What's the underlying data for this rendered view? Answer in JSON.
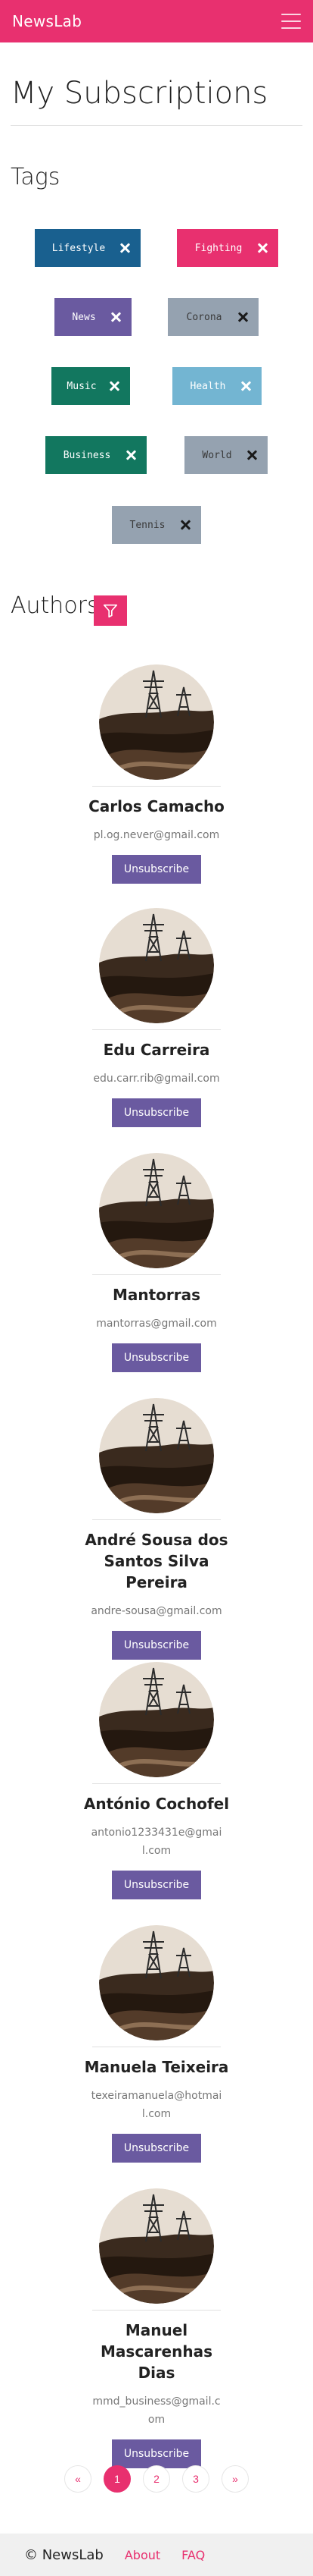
{
  "navbar": {
    "brand": "NewsLab",
    "menu_icon": "hamburger-icon"
  },
  "page": {
    "title": "My Subscriptions"
  },
  "tags_section": {
    "title": "Tags",
    "items": [
      {
        "label": "Lifestyle",
        "color": "#19608f",
        "text_color": "#ffffff"
      },
      {
        "label": "Fighting",
        "color": "#e8306f",
        "text_color": "#ffffff"
      },
      {
        "label": "News",
        "color": "#6a5aa0",
        "text_color": "#ffffff"
      },
      {
        "label": "Corona",
        "color": "#95a2b0",
        "text_color": "#3a3a3a"
      },
      {
        "label": "Music",
        "color": "#12775f",
        "text_color": "#ffffff"
      },
      {
        "label": "Health",
        "color": "#73b5d2",
        "text_color": "#ffffff"
      },
      {
        "label": "Business",
        "color": "#12775f",
        "text_color": "#ffffff"
      },
      {
        "label": "World",
        "color": "#95a2b0",
        "text_color": "#3a3a3a"
      },
      {
        "label": "Tennis",
        "color": "#95a2b0",
        "text_color": "#3a3a3a"
      }
    ]
  },
  "authors_section": {
    "title": "Authors",
    "filter_icon": "filter-icon",
    "unsubscribe_label": "Unsubscribe",
    "items": [
      {
        "name": "Carlos Camacho",
        "email": "pl.og.never@gmail.com"
      },
      {
        "name": "Edu Carreira",
        "email": "edu.carr.rib@gmail.com"
      },
      {
        "name": "Mantorras",
        "email": "mantorras@gmail.com"
      },
      {
        "name": "André Sousa dos Santos Silva Pereira",
        "email": "andre-sousa@gmail.com"
      },
      {
        "name": "António Cochofel",
        "email": "antonio1233431e@gmail.com"
      },
      {
        "name": "Manuela Teixeira",
        "email": "texeiramanuela@hotmail.com"
      },
      {
        "name": "Manuel Mascarenhas Dias",
        "email": "mmd_business@gmail.com"
      }
    ]
  },
  "pagination": {
    "prev": "«",
    "pages": [
      "1",
      "2",
      "3"
    ],
    "current": "1",
    "next": "»"
  },
  "footer": {
    "copyright": "© NewsLab",
    "about": "About",
    "faq": "FAQ"
  }
}
